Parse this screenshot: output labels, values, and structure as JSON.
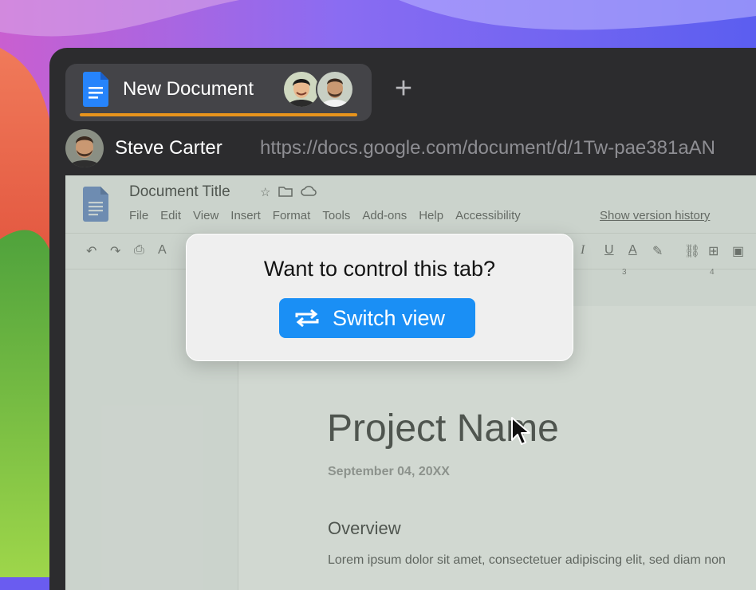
{
  "tab": {
    "title": "New Document",
    "accent_color": "#e8941c",
    "new_tab_icon": "plus-icon"
  },
  "address_bar": {
    "user_name": "Steve Carter",
    "url": "https://docs.google.com/document/d/1Tw-pae381aAN"
  },
  "gdocs": {
    "document_title": "Document Title",
    "menu": [
      "File",
      "Edit",
      "View",
      "Insert",
      "Format",
      "Tools",
      "Add-ons",
      "Help",
      "Accessibility"
    ],
    "version_history": "Show version history",
    "ruler_labels": [
      "3",
      "4"
    ]
  },
  "document": {
    "project_name": "Project Name",
    "date": "September 04, 20XX",
    "section_heading": "Overview",
    "body_text": "Lorem ipsum dolor sit amet, consectetuer adipiscing elit, sed diam non"
  },
  "popup": {
    "question": "Want to control this tab?",
    "button_label": "Switch view",
    "button_color": "#1a8ff5",
    "button_icon": "switch-arrows-icon"
  }
}
